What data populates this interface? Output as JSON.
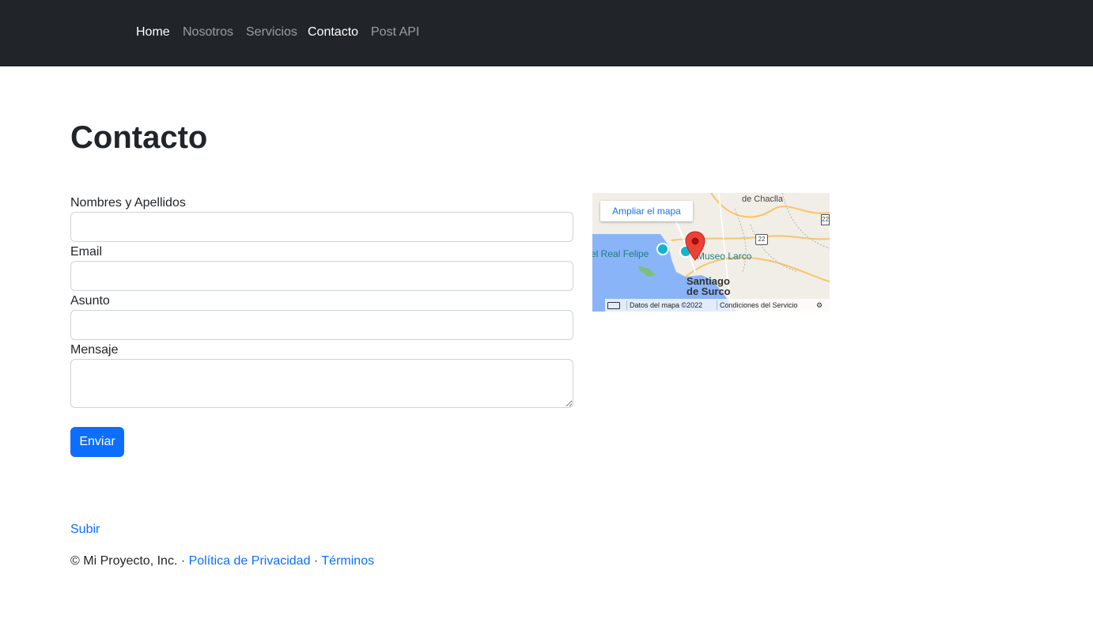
{
  "nav": {
    "items": [
      {
        "label": "Home",
        "active": true
      },
      {
        "label": "Nosotros",
        "active": false
      },
      {
        "label": "Servicios",
        "active": false
      },
      {
        "label": "Contacto",
        "active": true
      },
      {
        "label": "Post API",
        "active": false
      }
    ]
  },
  "page": {
    "title": "Contacto"
  },
  "form": {
    "fields": [
      {
        "label": "Nombres y Apellidos",
        "value": ""
      },
      {
        "label": "Email",
        "value": ""
      },
      {
        "label": "Asunto",
        "value": ""
      },
      {
        "label": "Mensaje",
        "value": ""
      }
    ],
    "submit_label": "Enviar"
  },
  "map": {
    "enlarge_label": "Ampliar el mapa",
    "place_labels": [
      "de Chaclla",
      "el Real Felipe",
      "Museo Larco",
      "Santiago",
      "de Surco"
    ],
    "road_labels": [
      "22",
      "22"
    ],
    "attribution": "Datos del mapa ©2022",
    "terms": "Condiciones del Servicio",
    "keyboard_icon": "keyboard-icon",
    "marker_icon": "map-pin-icon",
    "colors": {
      "water": "#8ab4f8",
      "land": "#f1eee7",
      "road": "#f8c46b",
      "marker": "#ea4335"
    }
  },
  "footer": {
    "back_to_top": "Subir",
    "copyright": "© Mi Proyecto, Inc. · ",
    "privacy": "Política de Privacidad",
    "separator": " · ",
    "terms": "Términos"
  },
  "colors": {
    "navbar": "#212529",
    "primary": "#0d6efd",
    "text": "#212529"
  }
}
